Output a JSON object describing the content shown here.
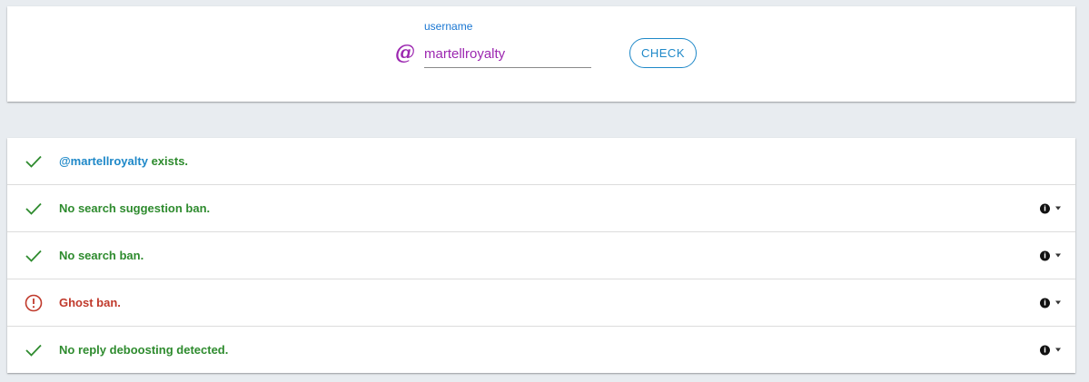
{
  "search": {
    "label": "username",
    "value": "martellroyalty",
    "at_icon": "@",
    "button_label": "CHECK"
  },
  "results": [
    {
      "status": "ok",
      "icon": "check-icon",
      "user": "@martellroyalty",
      "text": " exists.",
      "has_actions": false
    },
    {
      "status": "ok",
      "icon": "check-icon",
      "text": "No search suggestion ban.",
      "has_actions": true
    },
    {
      "status": "ok",
      "icon": "check-icon",
      "text": "No search ban.",
      "has_actions": true
    },
    {
      "status": "bad",
      "icon": "alert-circle-icon",
      "text": "Ghost ban.",
      "has_actions": true
    },
    {
      "status": "ok",
      "icon": "check-icon",
      "text": "No reply deboosting detected.",
      "has_actions": true
    }
  ],
  "colors": {
    "ok": "#2e8b2e",
    "bad": "#c0392b",
    "accent": "#1e88c8",
    "username": "#9c27b0"
  }
}
